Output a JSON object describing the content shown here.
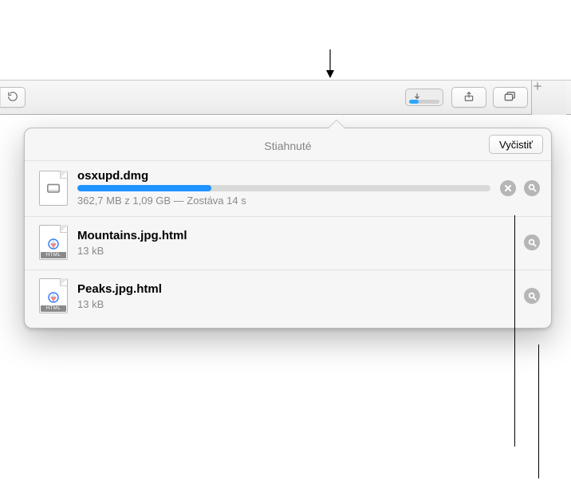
{
  "toolbar": {
    "download_progress_pct": 32,
    "reload_icon": "reload-icon",
    "share_icon": "share-icon",
    "tabs_icon": "tabs-icon",
    "new_tab_icon": "plus-icon",
    "downloads_icon": "downloads-arrow-icon"
  },
  "popover": {
    "title": "Stiahnuté",
    "clear_label": "Vyčistiť"
  },
  "downloads": [
    {
      "name": "osxupd.dmg",
      "meta": "362,7 MB z 1,09 GB — Zostáva 14 s",
      "in_progress": true,
      "progress_pct": 32.5,
      "icon_kind": "dmg",
      "icon_badge": ""
    },
    {
      "name": "Mountains.jpg.html",
      "meta": "13 kB",
      "in_progress": false,
      "icon_kind": "html",
      "icon_badge": "HTML"
    },
    {
      "name": "Peaks.jpg.html",
      "meta": "13 kB",
      "in_progress": false,
      "icon_kind": "html",
      "icon_badge": "HTML"
    }
  ]
}
